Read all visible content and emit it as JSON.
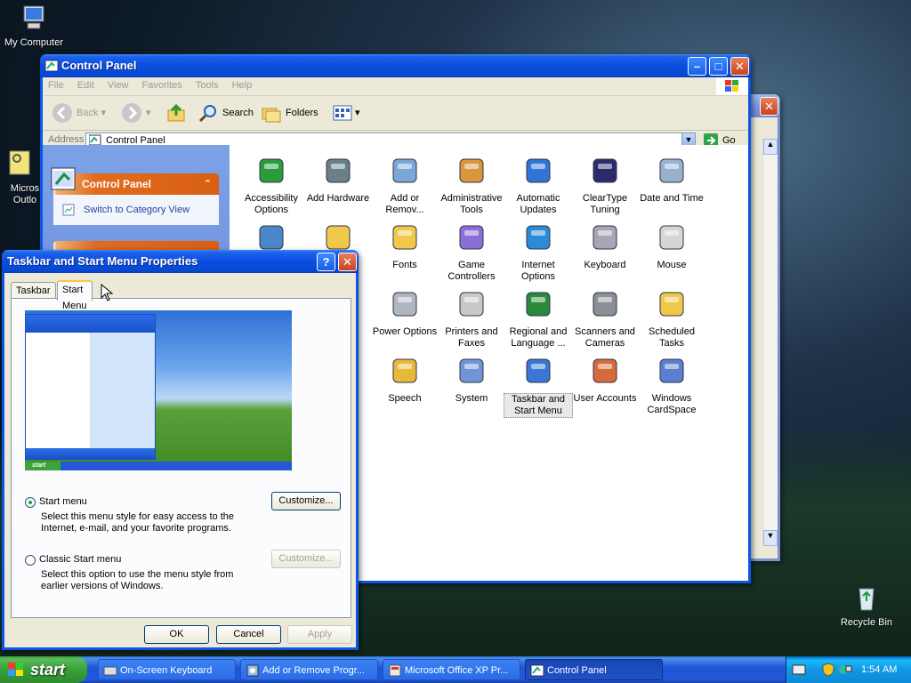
{
  "desktop": {
    "icons": [
      {
        "label": "My Computer"
      },
      {
        "label": "Micros Outlo"
      },
      {
        "label": "Recycle Bin"
      }
    ]
  },
  "control_panel": {
    "title": "Control Panel",
    "menu": [
      "File",
      "Edit",
      "View",
      "Favorites",
      "Tools",
      "Help"
    ],
    "toolbar": {
      "back": "Back",
      "search": "Search",
      "folders": "Folders"
    },
    "address_label": "Address",
    "address_value": "Control Panel",
    "go_label": "Go",
    "sidebar": {
      "panel_title": "Control Panel",
      "switch_view": "Switch to Category View"
    },
    "items": [
      {
        "label": "Accessibility Options",
        "icon": "accessibility-icon"
      },
      {
        "label": "Add Hardware",
        "icon": "hardware-icon"
      },
      {
        "label": "Add or Remov...",
        "icon": "add-remove-icon"
      },
      {
        "label": "Administrative Tools",
        "icon": "admin-tools-icon"
      },
      {
        "label": "Automatic Updates",
        "icon": "updates-icon"
      },
      {
        "label": "ClearType Tuning",
        "icon": "cleartype-icon"
      },
      {
        "label": "Date and Time",
        "icon": "clock-icon"
      },
      {
        "label": "Fonts",
        "icon": "fonts-folder-icon"
      },
      {
        "label": "Game Controllers",
        "icon": "gamepad-icon"
      },
      {
        "label": "Internet Options",
        "icon": "globe-icon"
      },
      {
        "label": "Keyboard",
        "icon": "keyboard-icon"
      },
      {
        "label": "Mouse",
        "icon": "mouse-icon"
      },
      {
        "label": "Power Options",
        "icon": "power-icon"
      },
      {
        "label": "Printers and Faxes",
        "icon": "printer-icon"
      },
      {
        "label": "Regional and Language ...",
        "icon": "regional-icon"
      },
      {
        "label": "Scanners and Cameras",
        "icon": "scanner-icon"
      },
      {
        "label": "Scheduled Tasks",
        "icon": "tasks-folder-icon"
      },
      {
        "label": "Speech",
        "icon": "speech-icon"
      },
      {
        "label": "System",
        "icon": "system-icon"
      },
      {
        "label": "Taskbar and Start Menu",
        "icon": "taskbar-icon"
      },
      {
        "label": "User Accounts",
        "icon": "users-icon"
      },
      {
        "label": "Windows CardSpace",
        "icon": "cardspace-icon"
      }
    ]
  },
  "dialog": {
    "title": "Taskbar and Start Menu Properties",
    "tabs": [
      "Taskbar",
      "Start Menu"
    ],
    "preview_start_label": "start",
    "options": [
      {
        "label": "Start menu",
        "desc": "Select this menu style for easy access to the Internet, e-mail, and your favorite programs.",
        "button": "Customize..."
      },
      {
        "label": "Classic Start menu",
        "desc": "Select this option to use the menu style from earlier versions of Windows.",
        "button": "Customize..."
      }
    ],
    "ok": "OK",
    "cancel": "Cancel",
    "apply": "Apply"
  },
  "taskbar": {
    "start": "start",
    "tasks": [
      "On-Screen Keyboard",
      "Add or Remove Progr...",
      "Microsoft Office XP Pr...",
      "Control Panel"
    ],
    "clock": "1:54 AM"
  },
  "colors": {
    "xp_blue": "#0a56e6",
    "sidebar_orange": "#e16b1d",
    "start_green": "#37a137"
  }
}
